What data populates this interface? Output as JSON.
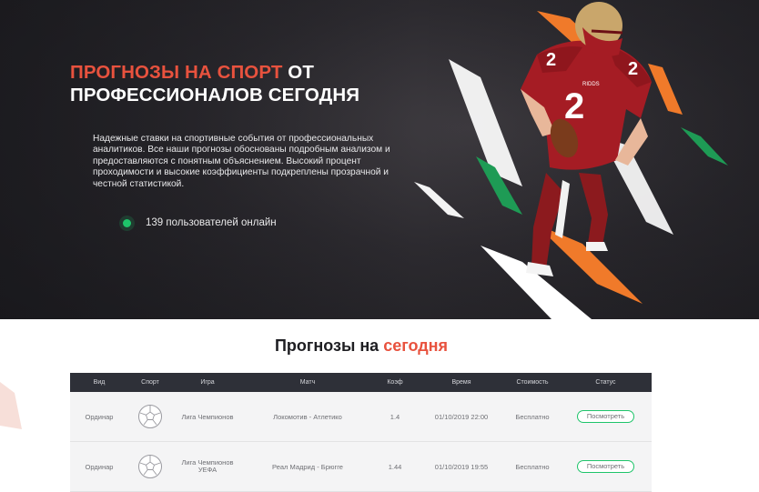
{
  "hero": {
    "title_accent": "Прогнозы на спорт",
    "title_rest_1": " от",
    "title_line_2": "профессионалов сегодня",
    "description": "Надежные ставки на спортивные события от профессиональных аналитиков. Все наши прогнозы обоснованы подробным анализом и предоставляются с понятным объяснением. Высокий процент проходимости и высокие коэффициенты подкреплены прозрачной и честной статистикой.",
    "online_text": "139 пользователей онлайн"
  },
  "section": {
    "title_main": "Прогнозы на ",
    "title_accent": "сегодня"
  },
  "table": {
    "headers": [
      "Вид",
      "Спорт",
      "Игра",
      "Матч",
      "Коэф",
      "Время",
      "Стоимость",
      "Статус"
    ],
    "rows": [
      {
        "type": "Ординар",
        "sport_icon": "soccer-ball-icon",
        "league": "Лига Чемпионов",
        "match": "Локомотив - Атлетико",
        "coef": "1.4",
        "time": "01/10/2019 22:00",
        "price": "Бесплатно",
        "status_button": "Посмотреть"
      },
      {
        "type": "Ординар",
        "sport_icon": "soccer-ball-icon",
        "league": "Лига Чемпионов УЕФА",
        "match": "Реал Мадрид - Брюгге",
        "coef": "1.44",
        "time": "01/10/2019 19:55",
        "price": "Бесплатно",
        "status_button": "Посмотреть"
      }
    ]
  },
  "player_image": {
    "jersey_number": "2",
    "jersey_lettering": "RIDDS"
  },
  "colors": {
    "accent": "#e8523e",
    "hero_bg": "#2c2a2f",
    "online_green": "#1ec46a",
    "shape_orange": "#f07a2a",
    "shape_green": "#1e9b55",
    "table_header_bg": "#2e3038"
  }
}
